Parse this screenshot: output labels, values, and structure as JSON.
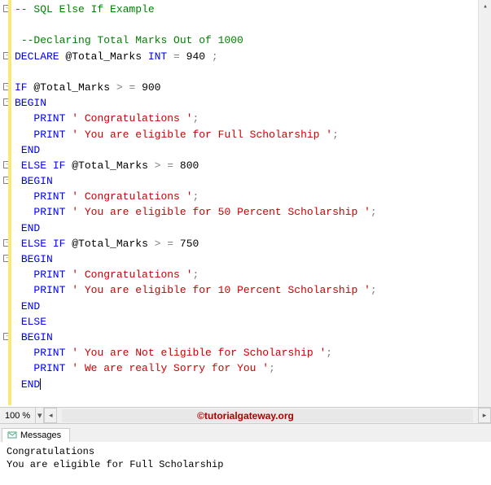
{
  "code": {
    "lines": [
      {
        "fold": true,
        "tokens": [
          [
            "c-comment",
            "-- SQL Else If Example"
          ]
        ]
      },
      {
        "fold": false,
        "tokens": []
      },
      {
        "fold": false,
        "tokens": [
          [
            "c-plain",
            " "
          ],
          [
            "c-comment",
            "--Declaring Total Marks Out of 1000"
          ]
        ]
      },
      {
        "fold": true,
        "tokens": [
          [
            "c-keyword",
            "DECLARE"
          ],
          [
            "c-plain",
            " @Total_Marks "
          ],
          [
            "c-keyword",
            "INT"
          ],
          [
            "c-plain",
            " "
          ],
          [
            "c-op",
            "="
          ],
          [
            "c-plain",
            " 940 "
          ],
          [
            "c-op",
            ";"
          ]
        ]
      },
      {
        "fold": false,
        "tokens": []
      },
      {
        "fold": true,
        "tokens": [
          [
            "c-keyword",
            "IF"
          ],
          [
            "c-plain",
            " @Total_Marks "
          ],
          [
            "c-op",
            ">"
          ],
          [
            "c-plain",
            " "
          ],
          [
            "c-op",
            "="
          ],
          [
            "c-plain",
            " 900"
          ]
        ]
      },
      {
        "fold": true,
        "tokens": [
          [
            "c-keyword",
            "BEGIN"
          ]
        ]
      },
      {
        "fold": false,
        "tokens": [
          [
            "c-plain",
            "   "
          ],
          [
            "c-keyword",
            "PRINT"
          ],
          [
            "c-plain",
            " "
          ],
          [
            "c-str",
            "' Congratulations '"
          ],
          [
            "c-op",
            ";"
          ]
        ]
      },
      {
        "fold": false,
        "tokens": [
          [
            "c-plain",
            "   "
          ],
          [
            "c-keyword",
            "PRINT"
          ],
          [
            "c-plain",
            " "
          ],
          [
            "c-str",
            "' You are eligible for Full Scholarship '"
          ],
          [
            "c-op",
            ";"
          ]
        ]
      },
      {
        "fold": false,
        "tokens": [
          [
            "c-plain",
            " "
          ],
          [
            "c-keyword",
            "END"
          ]
        ]
      },
      {
        "fold": true,
        "tokens": [
          [
            "c-plain",
            " "
          ],
          [
            "c-keyword",
            "ELSE"
          ],
          [
            "c-plain",
            " "
          ],
          [
            "c-keyword",
            "IF"
          ],
          [
            "c-plain",
            " @Total_Marks "
          ],
          [
            "c-op",
            ">"
          ],
          [
            "c-plain",
            " "
          ],
          [
            "c-op",
            "="
          ],
          [
            "c-plain",
            " 800"
          ]
        ]
      },
      {
        "fold": true,
        "tokens": [
          [
            "c-plain",
            " "
          ],
          [
            "c-keyword",
            "BEGIN"
          ]
        ]
      },
      {
        "fold": false,
        "tokens": [
          [
            "c-plain",
            "   "
          ],
          [
            "c-keyword",
            "PRINT"
          ],
          [
            "c-plain",
            " "
          ],
          [
            "c-str",
            "' Congratulations '"
          ],
          [
            "c-op",
            ";"
          ]
        ]
      },
      {
        "fold": false,
        "tokens": [
          [
            "c-plain",
            "   "
          ],
          [
            "c-keyword",
            "PRINT"
          ],
          [
            "c-plain",
            " "
          ],
          [
            "c-str",
            "' You are eligible for 50 Percent Scholarship '"
          ],
          [
            "c-op",
            ";"
          ]
        ]
      },
      {
        "fold": false,
        "tokens": [
          [
            "c-plain",
            " "
          ],
          [
            "c-keyword",
            "END"
          ]
        ]
      },
      {
        "fold": true,
        "tokens": [
          [
            "c-plain",
            " "
          ],
          [
            "c-keyword",
            "ELSE"
          ],
          [
            "c-plain",
            " "
          ],
          [
            "c-keyword",
            "IF"
          ],
          [
            "c-plain",
            " @Total_Marks "
          ],
          [
            "c-op",
            ">"
          ],
          [
            "c-plain",
            " "
          ],
          [
            "c-op",
            "="
          ],
          [
            "c-plain",
            " 750"
          ]
        ]
      },
      {
        "fold": true,
        "tokens": [
          [
            "c-plain",
            " "
          ],
          [
            "c-keyword",
            "BEGIN"
          ]
        ]
      },
      {
        "fold": false,
        "tokens": [
          [
            "c-plain",
            "   "
          ],
          [
            "c-keyword",
            "PRINT"
          ],
          [
            "c-plain",
            " "
          ],
          [
            "c-str",
            "' Congratulations '"
          ],
          [
            "c-op",
            ";"
          ]
        ]
      },
      {
        "fold": false,
        "tokens": [
          [
            "c-plain",
            "   "
          ],
          [
            "c-keyword",
            "PRINT"
          ],
          [
            "c-plain",
            " "
          ],
          [
            "c-str",
            "' You are eligible for 10 Percent Scholarship '"
          ],
          [
            "c-op",
            ";"
          ]
        ]
      },
      {
        "fold": false,
        "tokens": [
          [
            "c-plain",
            " "
          ],
          [
            "c-keyword",
            "END"
          ]
        ]
      },
      {
        "fold": false,
        "tokens": [
          [
            "c-plain",
            " "
          ],
          [
            "c-keyword",
            "ELSE"
          ]
        ]
      },
      {
        "fold": true,
        "tokens": [
          [
            "c-plain",
            " "
          ],
          [
            "c-keyword",
            "BEGIN"
          ]
        ]
      },
      {
        "fold": false,
        "tokens": [
          [
            "c-plain",
            "   "
          ],
          [
            "c-keyword",
            "PRINT"
          ],
          [
            "c-plain",
            " "
          ],
          [
            "c-str",
            "' You are Not eligible for Scholarship '"
          ],
          [
            "c-op",
            ";"
          ]
        ]
      },
      {
        "fold": false,
        "tokens": [
          [
            "c-plain",
            "   "
          ],
          [
            "c-keyword",
            "PRINT"
          ],
          [
            "c-plain",
            " "
          ],
          [
            "c-str",
            "' We are really Sorry for You '"
          ],
          [
            "c-op",
            ";"
          ]
        ]
      },
      {
        "fold": false,
        "tokens": [
          [
            "c-plain",
            " "
          ],
          [
            "c-keyword",
            "END"
          ]
        ]
      }
    ]
  },
  "zoom": {
    "label": "100 %"
  },
  "watermark": "©tutorialgateway.org",
  "messages": {
    "tab_label": "Messages",
    "output": [
      " Congratulations ",
      " You are eligible for Full Scholarship "
    ]
  }
}
